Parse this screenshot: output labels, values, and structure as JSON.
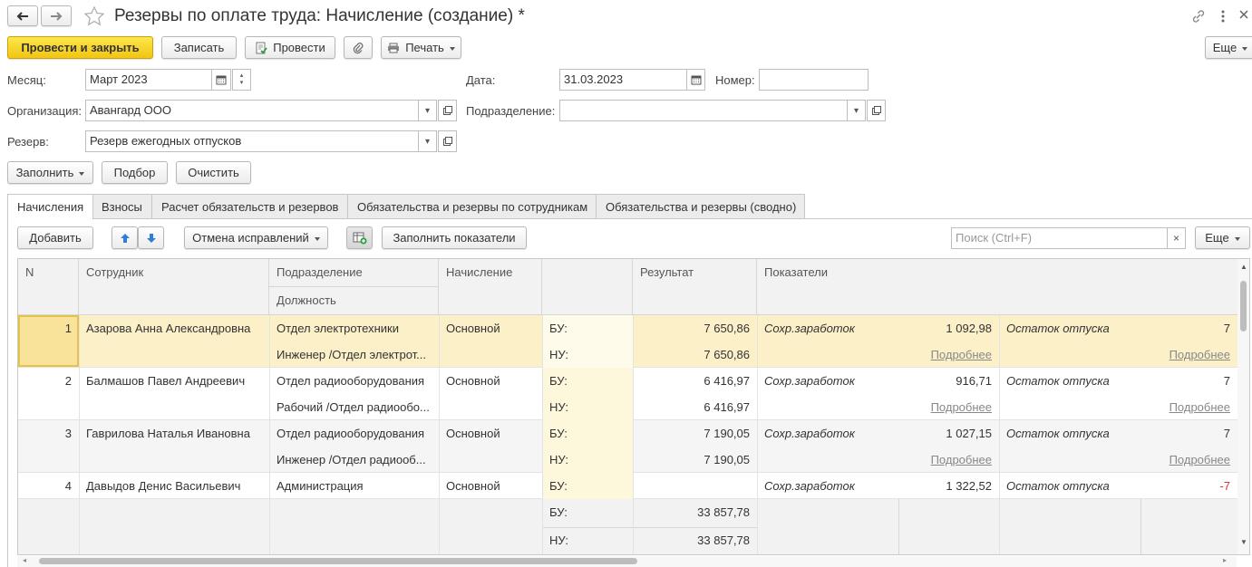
{
  "window": {
    "title": "Резервы по оплате труда: Начисление (создание) *"
  },
  "toolbar": {
    "post_close": "Провести и закрыть",
    "save": "Записать",
    "post": "Провести",
    "print": "Печать",
    "more": "Еще"
  },
  "form": {
    "month_label": "Месяц:",
    "month_value": "Март 2023",
    "date_label": "Дата:",
    "date_value": "31.03.2023",
    "number_label": "Номер:",
    "number_value": "",
    "org_label": "Организация:",
    "org_value": "Авангард ООО",
    "dept_label": "Подразделение:",
    "dept_value": "",
    "reserve_label": "Резерв:",
    "reserve_value": "Резерв ежегодных отпусков"
  },
  "actions": {
    "fill": "Заполнить",
    "select": "Подбор",
    "clear": "Очистить"
  },
  "tabs": [
    {
      "label": "Начисления"
    },
    {
      "label": "Взносы"
    },
    {
      "label": "Расчет обязательств и резервов"
    },
    {
      "label": "Обязательства и резервы по сотрудникам"
    },
    {
      "label": "Обязательства и резервы (сводно)"
    }
  ],
  "table_toolbar": {
    "add": "Добавить",
    "cancel_corrections": "Отмена исправлений",
    "fill_indicators": "Заполнить показатели",
    "search_placeholder": "Поиск (Ctrl+F)",
    "more": "Еще"
  },
  "columns": {
    "n": "N",
    "employee": "Сотрудник",
    "dept": "Подразделение",
    "position": "Должность",
    "accrual": "Начисление",
    "result": "Результат",
    "indicators": "Показатели"
  },
  "rows": [
    {
      "n": "1",
      "employee": "Азарова Анна Александровна",
      "dept": "Отдел электротехники",
      "position": "Инженер /Отдел электрот...",
      "accrual": "Основной",
      "bu": "БУ:",
      "nu": "НУ:",
      "result_bu": "7 650,86",
      "result_nu": "7 650,86",
      "ind1_name": "Сохр.заработок",
      "ind1_value": "1 092,98",
      "ind1_more": "Подробнее",
      "ind2_name": "Остаток отпуска",
      "ind2_value": "7",
      "ind2_more": "Подробнее"
    },
    {
      "n": "2",
      "employee": "Балмашов Павел Андреевич",
      "dept": "Отдел радиооборудования",
      "position": "Рабочий /Отдел радиообо...",
      "accrual": "Основной",
      "bu": "БУ:",
      "nu": "НУ:",
      "result_bu": "6 416,97",
      "result_nu": "6 416,97",
      "ind1_name": "Сохр.заработок",
      "ind1_value": "916,71",
      "ind1_more": "Подробнее",
      "ind2_name": "Остаток отпуска",
      "ind2_value": "7",
      "ind2_more": "Подробнее"
    },
    {
      "n": "3",
      "employee": "Гаврилова Наталья Ивановна",
      "dept": "Отдел радиооборудования",
      "position": "Инженер /Отдел радиооб...",
      "accrual": "Основной",
      "bu": "БУ:",
      "nu": "НУ:",
      "result_bu": "7 190,05",
      "result_nu": "7 190,05",
      "ind1_name": "Сохр.заработок",
      "ind1_value": "1 027,15",
      "ind1_more": "Подробнее",
      "ind2_name": "Остаток отпуска",
      "ind2_value": "7",
      "ind2_more": "Подробнее"
    },
    {
      "n": "4",
      "employee": "Давыдов Денис Васильевич",
      "dept": "Администрация",
      "position": "",
      "accrual": "Основной",
      "bu": "БУ:",
      "nu": "",
      "result_bu": "",
      "result_nu": "",
      "ind1_name": "Сохр.заработок",
      "ind1_value": "1 322,52",
      "ind1_more": "",
      "ind2_name": "Остаток отпуска",
      "ind2_value": "-7",
      "ind2_more": ""
    }
  ],
  "totals": {
    "bu_label": "БУ:",
    "nu_label": "НУ:",
    "bu_value": "33 857,78",
    "nu_value": "33 857,78"
  },
  "colors": {
    "primary_button": "#f1c512",
    "selected_row": "#fcf0c8",
    "result_column": "#fdf8dc",
    "negative": "#d43a2f"
  }
}
